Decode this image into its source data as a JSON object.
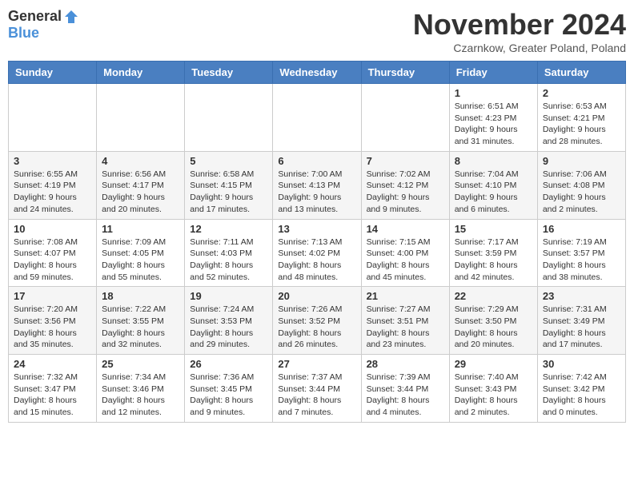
{
  "logo": {
    "general": "General",
    "blue": "Blue"
  },
  "title": "November 2024",
  "location": "Czarnkow, Greater Poland, Poland",
  "days_header": [
    "Sunday",
    "Monday",
    "Tuesday",
    "Wednesday",
    "Thursday",
    "Friday",
    "Saturday"
  ],
  "weeks": [
    [
      {
        "day": "",
        "info": ""
      },
      {
        "day": "",
        "info": ""
      },
      {
        "day": "",
        "info": ""
      },
      {
        "day": "",
        "info": ""
      },
      {
        "day": "",
        "info": ""
      },
      {
        "day": "1",
        "info": "Sunrise: 6:51 AM\nSunset: 4:23 PM\nDaylight: 9 hours\nand 31 minutes."
      },
      {
        "day": "2",
        "info": "Sunrise: 6:53 AM\nSunset: 4:21 PM\nDaylight: 9 hours\nand 28 minutes."
      }
    ],
    [
      {
        "day": "3",
        "info": "Sunrise: 6:55 AM\nSunset: 4:19 PM\nDaylight: 9 hours\nand 24 minutes."
      },
      {
        "day": "4",
        "info": "Sunrise: 6:56 AM\nSunset: 4:17 PM\nDaylight: 9 hours\nand 20 minutes."
      },
      {
        "day": "5",
        "info": "Sunrise: 6:58 AM\nSunset: 4:15 PM\nDaylight: 9 hours\nand 17 minutes."
      },
      {
        "day": "6",
        "info": "Sunrise: 7:00 AM\nSunset: 4:13 PM\nDaylight: 9 hours\nand 13 minutes."
      },
      {
        "day": "7",
        "info": "Sunrise: 7:02 AM\nSunset: 4:12 PM\nDaylight: 9 hours\nand 9 minutes."
      },
      {
        "day": "8",
        "info": "Sunrise: 7:04 AM\nSunset: 4:10 PM\nDaylight: 9 hours\nand 6 minutes."
      },
      {
        "day": "9",
        "info": "Sunrise: 7:06 AM\nSunset: 4:08 PM\nDaylight: 9 hours\nand 2 minutes."
      }
    ],
    [
      {
        "day": "10",
        "info": "Sunrise: 7:08 AM\nSunset: 4:07 PM\nDaylight: 8 hours\nand 59 minutes."
      },
      {
        "day": "11",
        "info": "Sunrise: 7:09 AM\nSunset: 4:05 PM\nDaylight: 8 hours\nand 55 minutes."
      },
      {
        "day": "12",
        "info": "Sunrise: 7:11 AM\nSunset: 4:03 PM\nDaylight: 8 hours\nand 52 minutes."
      },
      {
        "day": "13",
        "info": "Sunrise: 7:13 AM\nSunset: 4:02 PM\nDaylight: 8 hours\nand 48 minutes."
      },
      {
        "day": "14",
        "info": "Sunrise: 7:15 AM\nSunset: 4:00 PM\nDaylight: 8 hours\nand 45 minutes."
      },
      {
        "day": "15",
        "info": "Sunrise: 7:17 AM\nSunset: 3:59 PM\nDaylight: 8 hours\nand 42 minutes."
      },
      {
        "day": "16",
        "info": "Sunrise: 7:19 AM\nSunset: 3:57 PM\nDaylight: 8 hours\nand 38 minutes."
      }
    ],
    [
      {
        "day": "17",
        "info": "Sunrise: 7:20 AM\nSunset: 3:56 PM\nDaylight: 8 hours\nand 35 minutes."
      },
      {
        "day": "18",
        "info": "Sunrise: 7:22 AM\nSunset: 3:55 PM\nDaylight: 8 hours\nand 32 minutes."
      },
      {
        "day": "19",
        "info": "Sunrise: 7:24 AM\nSunset: 3:53 PM\nDaylight: 8 hours\nand 29 minutes."
      },
      {
        "day": "20",
        "info": "Sunrise: 7:26 AM\nSunset: 3:52 PM\nDaylight: 8 hours\nand 26 minutes."
      },
      {
        "day": "21",
        "info": "Sunrise: 7:27 AM\nSunset: 3:51 PM\nDaylight: 8 hours\nand 23 minutes."
      },
      {
        "day": "22",
        "info": "Sunrise: 7:29 AM\nSunset: 3:50 PM\nDaylight: 8 hours\nand 20 minutes."
      },
      {
        "day": "23",
        "info": "Sunrise: 7:31 AM\nSunset: 3:49 PM\nDaylight: 8 hours\nand 17 minutes."
      }
    ],
    [
      {
        "day": "24",
        "info": "Sunrise: 7:32 AM\nSunset: 3:47 PM\nDaylight: 8 hours\nand 15 minutes."
      },
      {
        "day": "25",
        "info": "Sunrise: 7:34 AM\nSunset: 3:46 PM\nDaylight: 8 hours\nand 12 minutes."
      },
      {
        "day": "26",
        "info": "Sunrise: 7:36 AM\nSunset: 3:45 PM\nDaylight: 8 hours\nand 9 minutes."
      },
      {
        "day": "27",
        "info": "Sunrise: 7:37 AM\nSunset: 3:44 PM\nDaylight: 8 hours\nand 7 minutes."
      },
      {
        "day": "28",
        "info": "Sunrise: 7:39 AM\nSunset: 3:44 PM\nDaylight: 8 hours\nand 4 minutes."
      },
      {
        "day": "29",
        "info": "Sunrise: 7:40 AM\nSunset: 3:43 PM\nDaylight: 8 hours\nand 2 minutes."
      },
      {
        "day": "30",
        "info": "Sunrise: 7:42 AM\nSunset: 3:42 PM\nDaylight: 8 hours\nand 0 minutes."
      }
    ]
  ]
}
